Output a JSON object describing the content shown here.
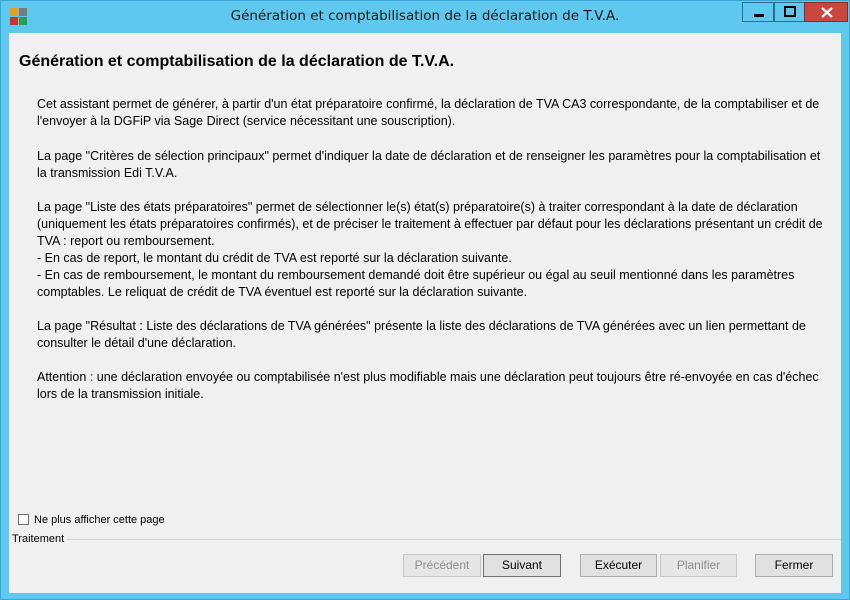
{
  "window": {
    "title": "Génération et comptabilisation de la déclaration de T.V.A."
  },
  "page": {
    "heading": "Génération et comptabilisation de la déclaration de T.V.A.",
    "paragraphs": [
      "Cet assistant permet de générer, à partir d'un état préparatoire confirmé, la déclaration de TVA CA3 correspondante, de la comptabiliser et de l'envoyer à la DGFiP via Sage Direct (service nécessitant une souscription).",
      "La page \"Critères de sélection principaux\" permet d'indiquer la date de déclaration et de renseigner les paramètres pour la comptabilisation et la transmission Edi T.V.A.",
      "La page \"Liste des états préparatoires\" permet de sélectionner le(s) état(s) préparatoire(s) à traiter correspondant à la date de déclaration (uniquement les états préparatoires confirmés), et de préciser le traitement à effectuer par défaut pour les déclarations présentant un crédit de TVA : report ou remboursement.\n- En cas de report, le montant du crédit de TVA est reporté sur la déclaration suivante.\n- En cas de remboursement, le montant du remboursement demandé doit être supérieur ou égal au seuil mentionné dans les paramètres comptables. Le reliquat de crédit de TVA éventuel est reporté sur la déclaration suivante.",
      "La page \"Résultat : Liste des déclarations de TVA générées\" présente la liste des déclarations de TVA générées avec un lien permettant de consulter le détail d'une déclaration.",
      "Attention : une déclaration envoyée ou comptabilisée n'est plus modifiable mais une déclaration peut toujours être ré-envoyée en cas d'échec lors de la transmission initiale."
    ]
  },
  "options": {
    "dont_show_label": "Ne plus afficher cette page",
    "dont_show_checked": false
  },
  "footer": {
    "group_label": "Traitement",
    "buttons": {
      "previous": "Précédent",
      "next": "Suivant",
      "execute": "Exécuter",
      "schedule": "Planifier",
      "close": "Fermer"
    }
  },
  "colors": {
    "titlebar": "#5ec8ee",
    "close_button": "#c9473c",
    "client_bg": "#f0f0f0"
  }
}
